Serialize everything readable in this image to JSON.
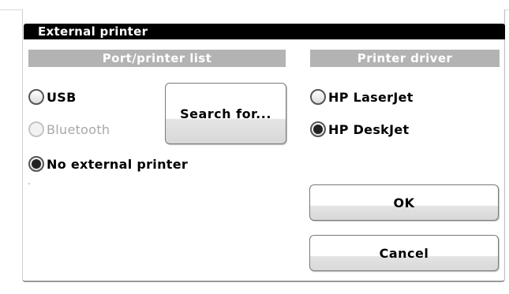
{
  "dialog": {
    "title": "External printer"
  },
  "port_section": {
    "header": "Port/printer list",
    "options": [
      {
        "label": "USB",
        "checked": false,
        "enabled": true
      },
      {
        "label": "Bluetooth",
        "checked": false,
        "enabled": false
      },
      {
        "label": "No external printer",
        "checked": true,
        "enabled": true
      }
    ],
    "search_button": "Search for..."
  },
  "driver_section": {
    "header": "Printer driver",
    "options": [
      {
        "label": "HP LaserJet",
        "checked": false,
        "enabled": true
      },
      {
        "label": "HP DeskJet",
        "checked": true,
        "enabled": true
      }
    ]
  },
  "buttons": {
    "ok": "OK",
    "cancel": "Cancel"
  }
}
